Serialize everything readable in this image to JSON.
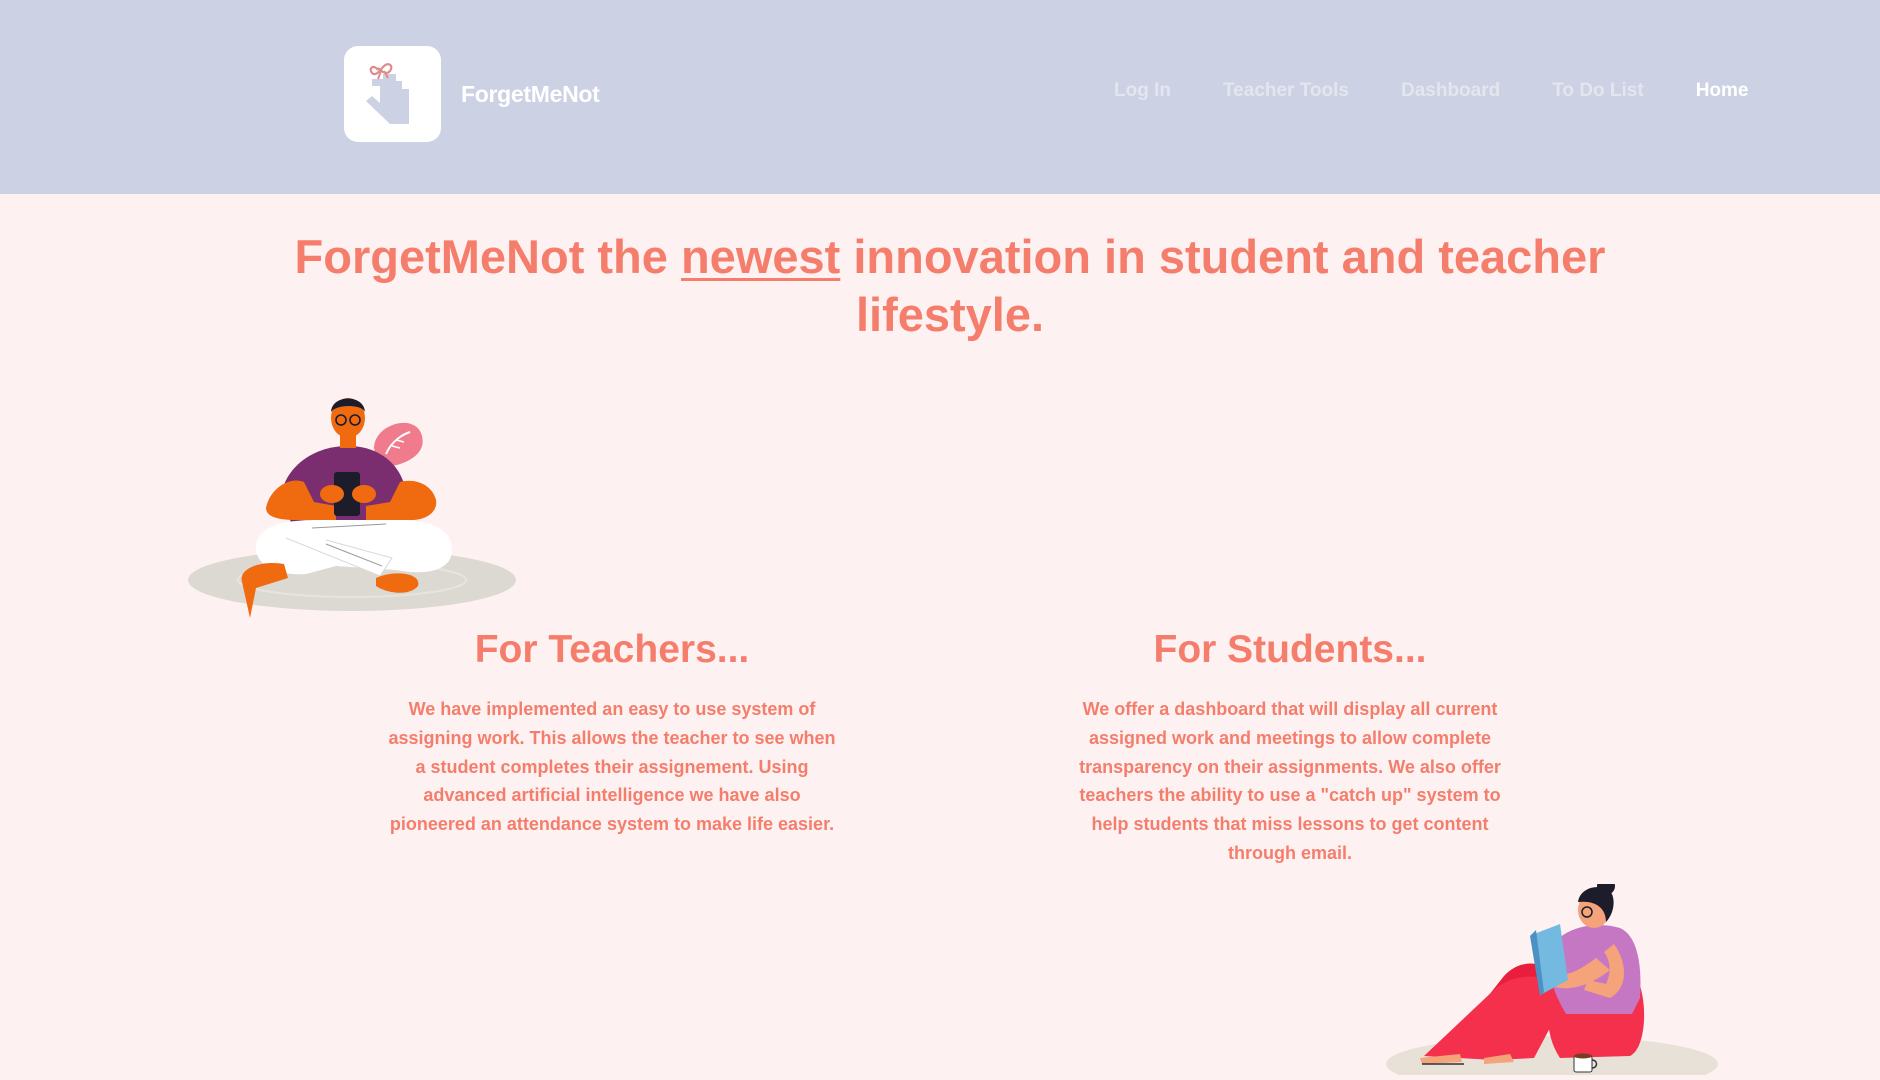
{
  "nav": {
    "brand_name": "ForgetMeNot",
    "links": [
      {
        "label": "Log In"
      },
      {
        "label": "Teacher Tools"
      },
      {
        "label": "Dashboard"
      },
      {
        "label": "To Do List"
      },
      {
        "label": "Home"
      }
    ],
    "active": "Home"
  },
  "hero": {
    "title_before": "ForgetMeNot the ",
    "title_emphasis": "newest",
    "title_after": " innovation in student and teacher lifestyle."
  },
  "teachers": {
    "heading": "For Teachers...",
    "body": "We have implemented an easy to use system of assigning work. This allows the teacher to see when a student completes their assignement. Using advanced artificial intelligence we have also pioneered an attendance system to make life easier."
  },
  "students": {
    "heading": "For Students...",
    "body": "We offer a dashboard that will display all current assigned work and meetings to allow complete transparency on their assignments. We also offer teachers the ability to use a \"catch up\" system to help students that miss lessons to get content through email."
  },
  "colors": {
    "nav_bg": "#cdd1e4",
    "page_bg": "#fdf2f1",
    "accent": "#f57d6c"
  },
  "icons": {
    "logo": "hand-with-ribbon-icon"
  }
}
